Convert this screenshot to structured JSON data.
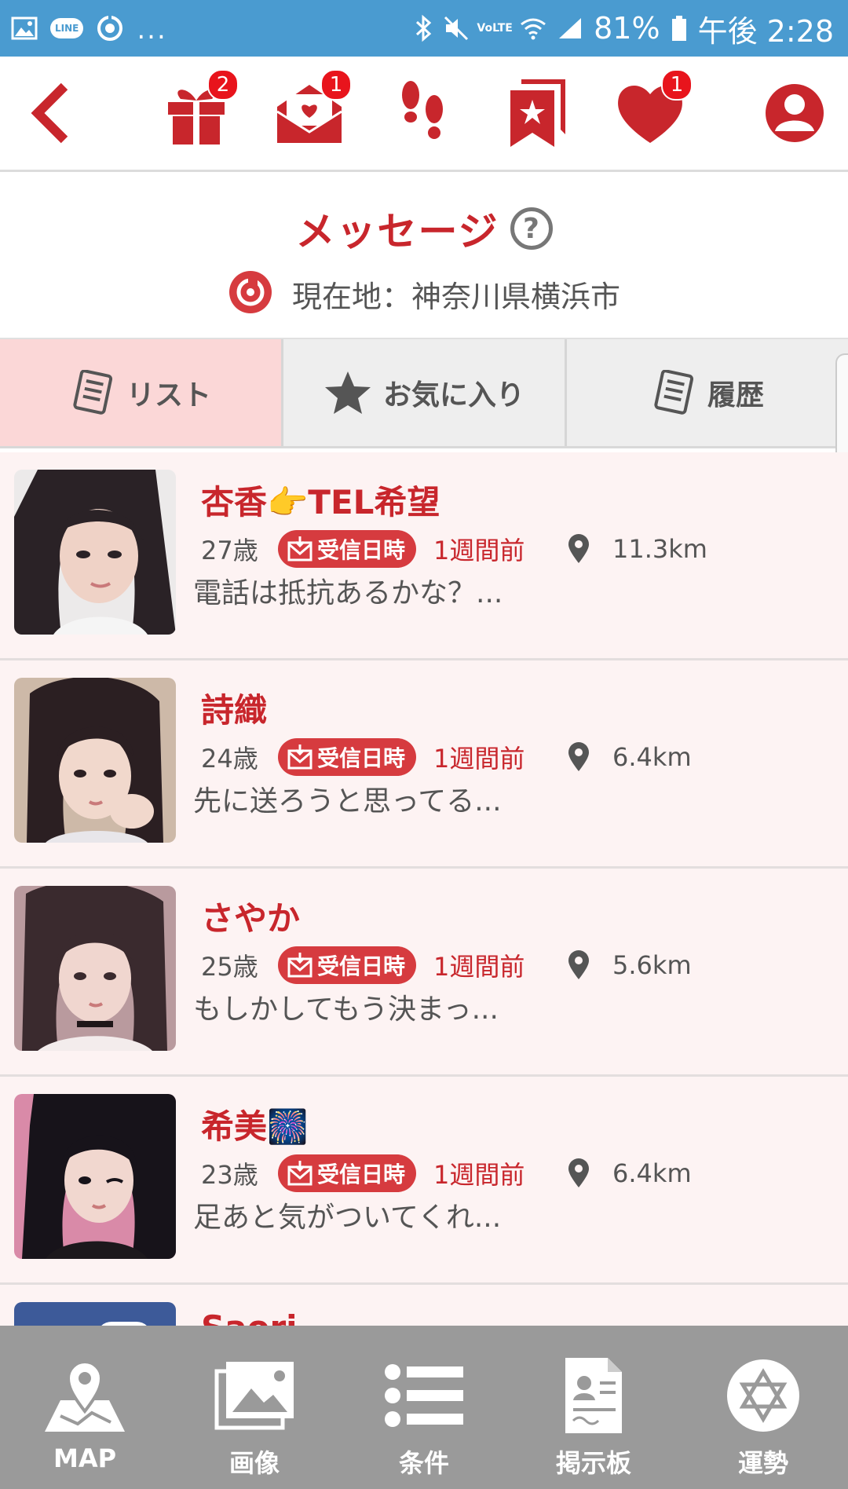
{
  "status_bar": {
    "line_label": "LINE",
    "more": "...",
    "volte": "VoLTE",
    "battery": "81%",
    "time": "午後 2:28"
  },
  "top_nav": {
    "gift_badge": "2",
    "mail_badge": "1",
    "like_badge": "1"
  },
  "header": {
    "title": "メッセージ",
    "help": "?",
    "location": "現在地：神奈川県横浜市"
  },
  "tabs": [
    {
      "label": "リスト",
      "icon": "list-icon",
      "active": true
    },
    {
      "label": "お気に入り",
      "icon": "star-icon",
      "active": false
    },
    {
      "label": "履歴",
      "icon": "history-icon",
      "active": false
    }
  ],
  "messages": [
    {
      "name": "杏香👉TEL希望",
      "age": "27歳",
      "badge": "受信日時",
      "when": "1週間前",
      "distance": "11.3km",
      "preview": "電話は抵抗あるかな？..."
    },
    {
      "name": "詩織",
      "age": "24歳",
      "badge": "受信日時",
      "when": "1週間前",
      "distance": "6.4km",
      "preview": "先に送ろうと思ってる..."
    },
    {
      "name": "さやか",
      "age": "25歳",
      "badge": "受信日時",
      "when": "1週間前",
      "distance": "5.6km",
      "preview": "もしかしてもう決まっ..."
    },
    {
      "name": "希美🎆",
      "age": "23歳",
      "badge": "受信日時",
      "when": "1週間前",
      "distance": "6.4km",
      "preview": "足あと気がついてくれ..."
    },
    {
      "name": "Saori",
      "age": "",
      "badge": "",
      "when": "",
      "distance": "",
      "preview": ""
    }
  ],
  "bottom_nav": [
    {
      "label": "MAP",
      "icon": "map-icon"
    },
    {
      "label": "画像",
      "icon": "images-icon"
    },
    {
      "label": "条件",
      "icon": "conditions-list-icon"
    },
    {
      "label": "掲示板",
      "icon": "bulletin-board-icon"
    },
    {
      "label": "運勢",
      "icon": "fortune-star-icon"
    }
  ],
  "colors": {
    "status_bar": "#4a9bd0",
    "accent_red": "#c8262c",
    "badge_red": "#e8141c",
    "active_tab": "#fbd7d7",
    "row_bg": "#fdf3f3",
    "bottom_nav": "#9a9a9a"
  }
}
